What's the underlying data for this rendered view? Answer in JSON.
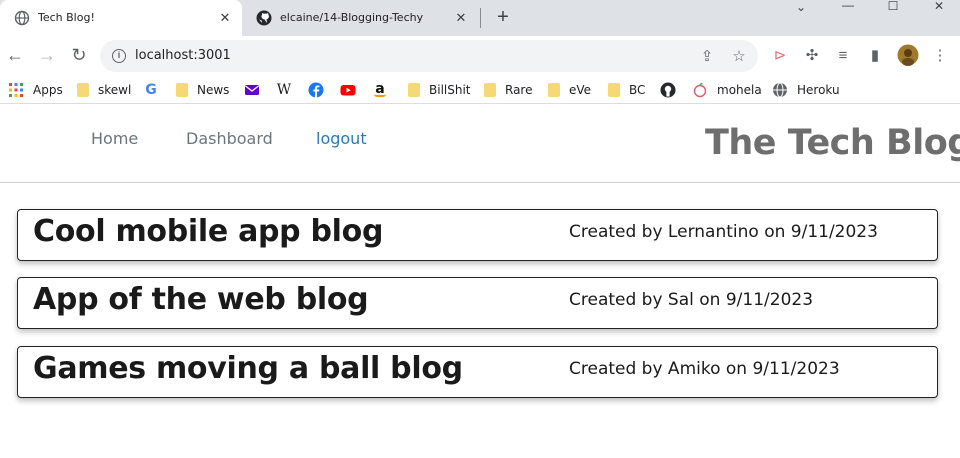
{
  "browser": {
    "tabs": [
      {
        "title": "Tech Blog!",
        "active": true,
        "icon": "globe-icon"
      },
      {
        "title": "elcaine/14-Blogging-Techy",
        "active": false,
        "icon": "github-icon"
      }
    ],
    "url": "localhost:3001",
    "bookmarks": [
      {
        "label": "Apps",
        "icon": "apps-grid-icon"
      },
      {
        "label": "skewl",
        "icon": "folder-icon"
      },
      {
        "label": "",
        "icon": "google-icon"
      },
      {
        "label": "News",
        "icon": "folder-icon"
      },
      {
        "label": "",
        "icon": "mail-icon"
      },
      {
        "label": "",
        "icon": "wikipedia-icon"
      },
      {
        "label": "",
        "icon": "facebook-icon"
      },
      {
        "label": "",
        "icon": "youtube-icon"
      },
      {
        "label": "",
        "icon": "amazon-icon"
      },
      {
        "label": "BillShit",
        "icon": "folder-icon"
      },
      {
        "label": "Rare",
        "icon": "folder-icon"
      },
      {
        "label": "eVe",
        "icon": "folder-icon"
      },
      {
        "label": "BC",
        "icon": "folder-icon"
      },
      {
        "label": "",
        "icon": "github-icon"
      },
      {
        "label": "mohela",
        "icon": "mohela-icon"
      },
      {
        "label": "Heroku",
        "icon": "globe-icon"
      }
    ]
  },
  "site": {
    "nav": {
      "home": "Home",
      "dashboard": "Dashboard",
      "logout": "logout"
    },
    "title": "The Tech Blog!",
    "link_color": "#2a7ab9"
  },
  "posts": [
    {
      "title": "Cool mobile app blog",
      "meta": "Created by Lernantino on 9/11/2023"
    },
    {
      "title": "App of the web blog",
      "meta": "Created by Sal on 9/11/2023"
    },
    {
      "title": "Games moving a ball blog",
      "meta": "Created by Amiko on 9/11/2023"
    }
  ]
}
